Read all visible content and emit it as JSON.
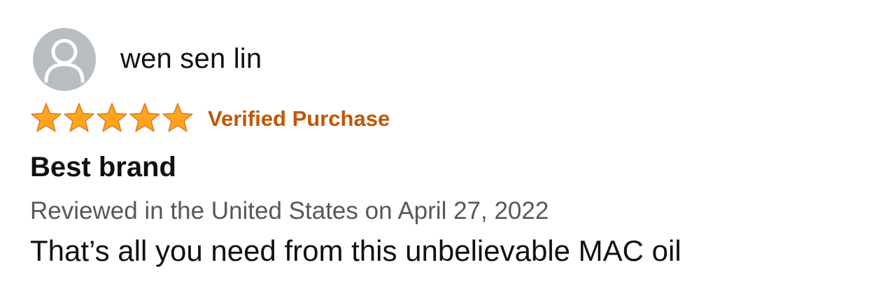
{
  "reviewer": {
    "name": "wen sen lin",
    "avatar_icon": "default-user-icon",
    "avatar_bg": "#b7bdc1"
  },
  "rating": {
    "stars": 5,
    "max_stars": 5,
    "star_color": "#ffa41c",
    "star_outline": "#de7921",
    "badge": "Verified Purchase",
    "badge_color": "#c45500"
  },
  "review": {
    "title": "Best brand",
    "date_line": "Reviewed in the United States on April 27, 2022",
    "body": "That’s all you need from this unbelievable MAC oil"
  }
}
